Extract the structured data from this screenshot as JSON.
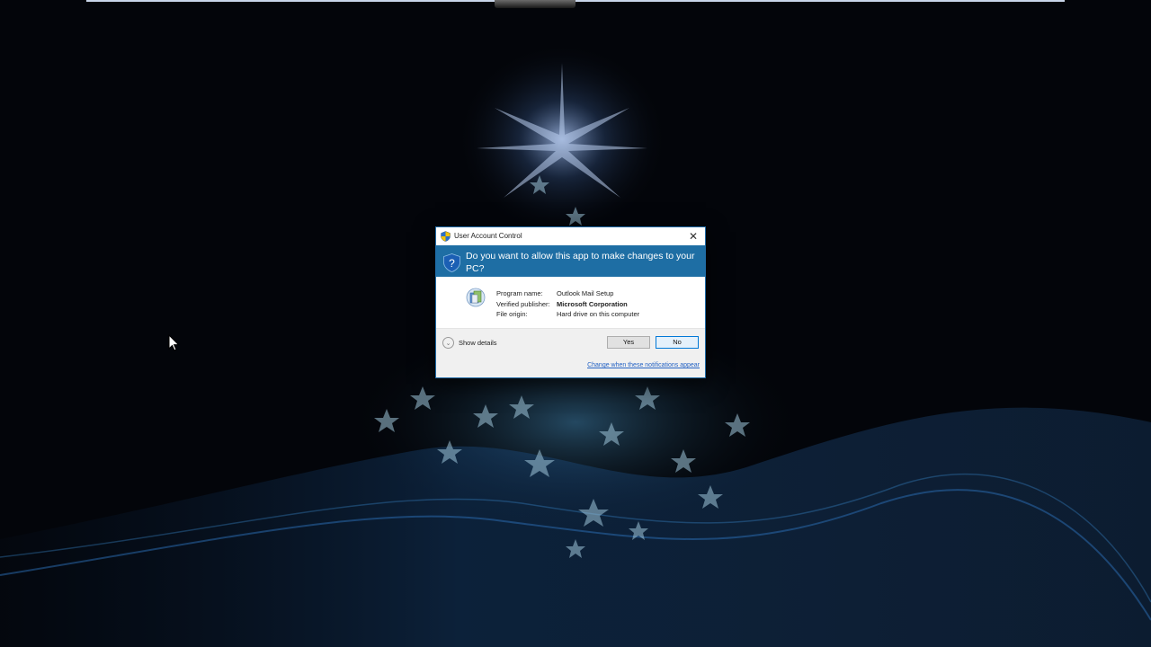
{
  "uac": {
    "title": "User Account Control",
    "prompt": "Do you want to allow this app to make changes to your PC?",
    "program_name_label": "Program name:",
    "program_name": "Outlook Mail Setup",
    "publisher_label": "Verified publisher:",
    "publisher": "Microsoft Corporation",
    "origin_label": "File origin:",
    "origin": "Hard drive on this computer",
    "show_details": "Show details",
    "yes": "Yes",
    "no": "No",
    "change_link": "Change when these notifications appear",
    "close": "✕"
  },
  "colors": {
    "banner": "#1e6ea4",
    "desktop": "#03050a",
    "link": "#2563c4"
  },
  "icons": {
    "title": "uac-shield-icon",
    "banner": "question-shield-icon",
    "program": "setup-program-icon",
    "cursor": "mouse-pointer-icon"
  }
}
